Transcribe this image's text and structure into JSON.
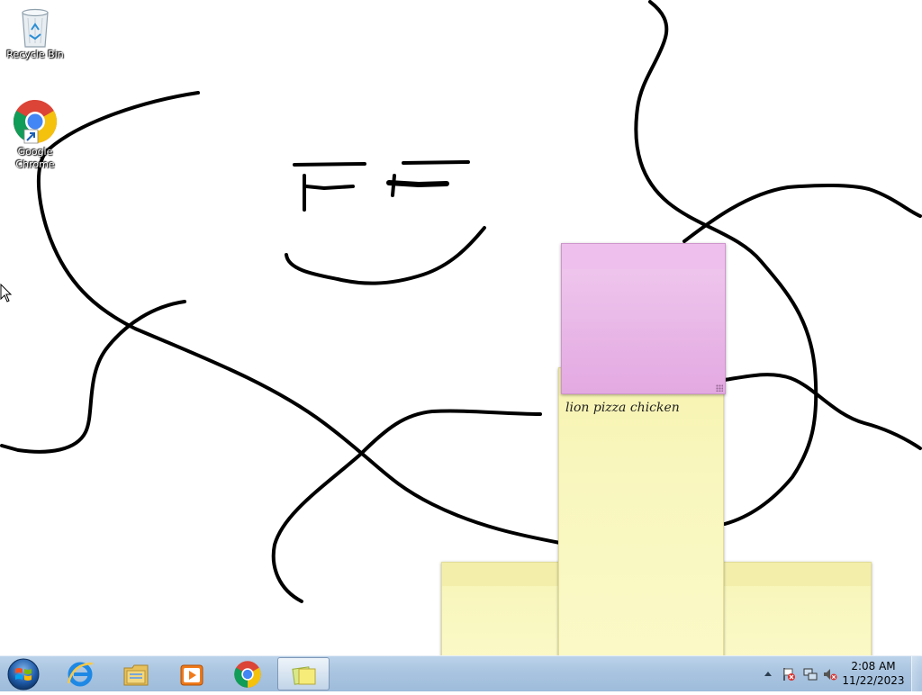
{
  "desktop": {
    "icons": [
      {
        "label": "Recycle Bin",
        "icon": "recycle-bin-icon"
      },
      {
        "label": "Google Chrome",
        "icon": "chrome-icon"
      }
    ]
  },
  "sticky_notes": [
    {
      "color": "#ecc0ea",
      "text": ""
    },
    {
      "color": "#f9f7bf",
      "text": "lion pizza chicken"
    },
    {
      "color": "#f9f7bf",
      "text": ""
    },
    {
      "color": "#f9f7bf",
      "text": ""
    }
  ],
  "taskbar": {
    "start_icon": "windows-orb-icon",
    "pinned": [
      {
        "icon": "internet-explorer-icon"
      },
      {
        "icon": "file-explorer-icon"
      },
      {
        "icon": "media-player-icon"
      },
      {
        "icon": "chrome-icon"
      },
      {
        "icon": "sticky-notes-icon",
        "active": true
      }
    ],
    "tray": {
      "icons": [
        "show-hidden-icons-chevron",
        "action-center-flag-icon",
        "network-icon",
        "volume-muted-icon"
      ],
      "time": "2:08 AM",
      "date": "11/22/2023"
    }
  },
  "colors": {
    "taskbar": "#a9c4e0",
    "ink": "#000000"
  }
}
